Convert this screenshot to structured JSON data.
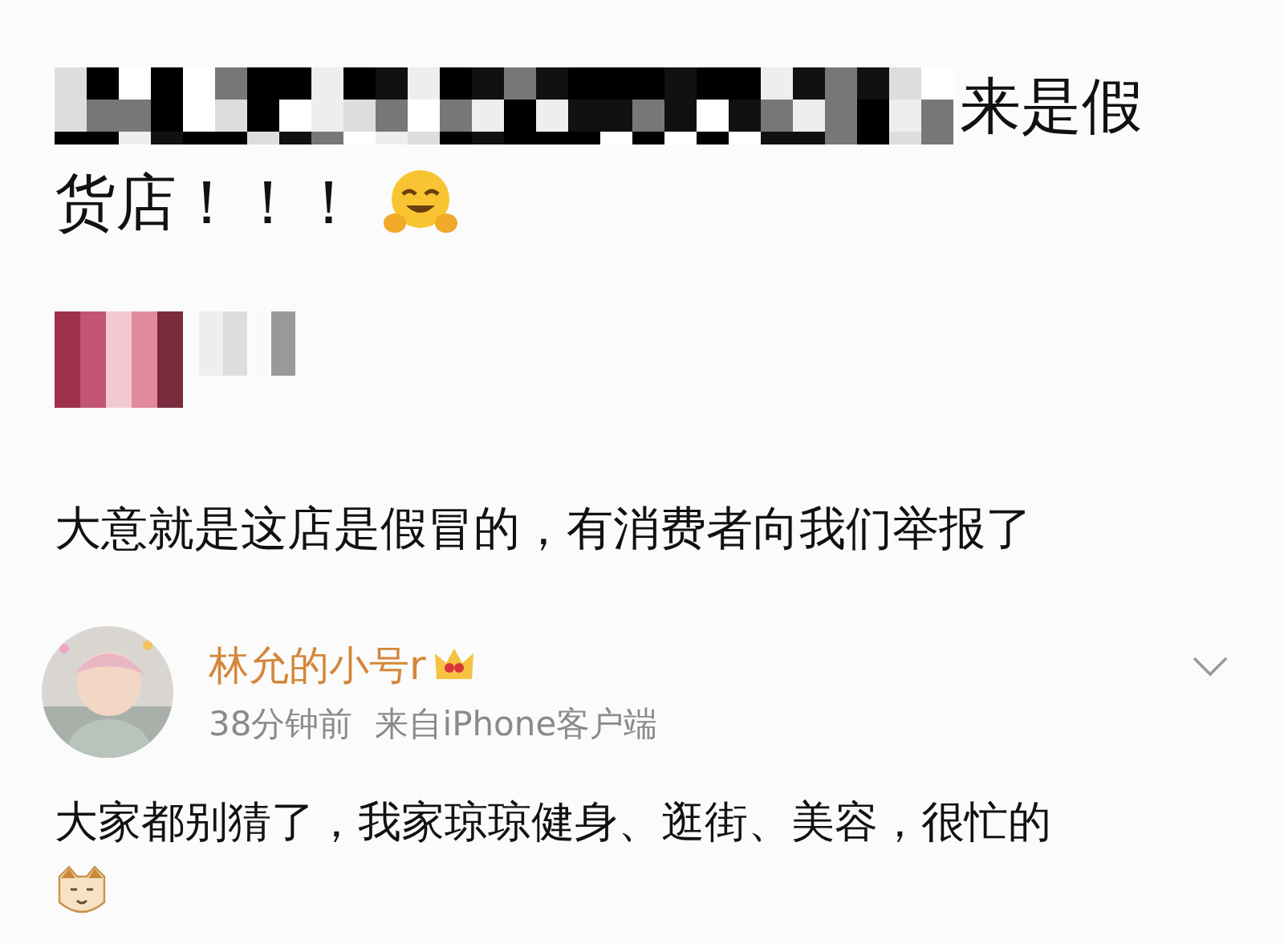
{
  "post": {
    "line_1_visible": "来是假",
    "line_2": "货店！！！"
  },
  "reply": {
    "text": "大意就是这店是假冒的，有消费者向我们举报了"
  },
  "comment": {
    "username": "林允的小号r",
    "time": "38分钟前",
    "source": "来自iPhone客户端",
    "text": "大家都别猜了，我家琼琼健身、逛街、美容，很忙的"
  }
}
